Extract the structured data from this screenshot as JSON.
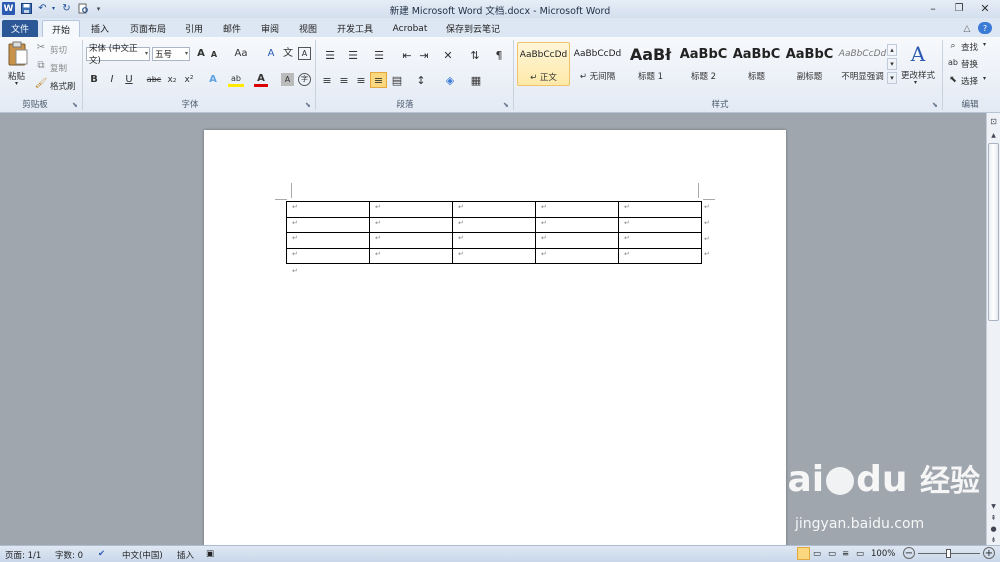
{
  "window": {
    "title": "新建 Microsoft Word 文档.docx - Microsoft Word",
    "app_logo_letter": "W",
    "controls": {
      "minimize": "–",
      "maximize": "❐",
      "close": "✕"
    }
  },
  "quick_access": {
    "save": "💾",
    "undo": "↶",
    "redo": "↻",
    "print_preview": "🔍",
    "customize": "▾"
  },
  "tabs": [
    {
      "label": "文件",
      "id": "file"
    },
    {
      "label": "开始",
      "id": "home"
    },
    {
      "label": "插入",
      "id": "insert"
    },
    {
      "label": "页面布局",
      "id": "layout"
    },
    {
      "label": "引用",
      "id": "references"
    },
    {
      "label": "邮件",
      "id": "mailings"
    },
    {
      "label": "审阅",
      "id": "review"
    },
    {
      "label": "视图",
      "id": "view"
    },
    {
      "label": "开发工具",
      "id": "developer"
    },
    {
      "label": "Acrobat",
      "id": "acrobat"
    },
    {
      "label": "保存到云笔记",
      "id": "cloudnote"
    }
  ],
  "ribbon_right_icons": {
    "help": "?",
    "collapse": "△"
  },
  "clipboard": {
    "group_label": "剪贴板",
    "paste": "粘贴",
    "cut": "剪切",
    "copy": "复制",
    "format_painter": "格式刷"
  },
  "font": {
    "group_label": "字体",
    "font_name": "宋体 (中文正文)",
    "font_size": "五号",
    "grow": "A",
    "shrink": "A",
    "change_case": "Aa",
    "clear": "A",
    "phonetic": "文",
    "border": "A",
    "bold": "B",
    "italic": "I",
    "underline": "U",
    "strike": "abc",
    "subscript": "x₂",
    "superscript": "x²",
    "text_effect": "A",
    "highlight": "ab",
    "font_color": "A",
    "shading": "A",
    "enclose": "字"
  },
  "paragraph": {
    "group_label": "段落"
  },
  "styles": {
    "group_label": "样式",
    "items": [
      {
        "preview": "AaBbCcDd",
        "name": "↵ 正文"
      },
      {
        "preview": "AaBbCcDd",
        "name": "↵ 无间隔"
      },
      {
        "preview": "AaBł",
        "name": "标题 1"
      },
      {
        "preview": "AaBbC",
        "name": "标题 2"
      },
      {
        "preview": "AaBbC",
        "name": "标题"
      },
      {
        "preview": "AaBbC",
        "name": "副标题"
      },
      {
        "preview": "AaBbCcDd",
        "name": "不明显强调"
      }
    ],
    "change_styles": "更改样式"
  },
  "editing": {
    "group_label": "编辑",
    "find": "查找",
    "replace": "替换",
    "select": "选择"
  },
  "document": {
    "table": {
      "rows": 4,
      "cols": 5,
      "cell_mark": "↵",
      "row_end_mark": "↵"
    },
    "paragraph_mark": "↵"
  },
  "statusbar": {
    "page": "页面: 1/1",
    "words": "字数: 0",
    "language": "中文(中国)",
    "mode": "插入",
    "zoom": "100%",
    "zoom_out": "−",
    "zoom_in": "+"
  },
  "watermark": {
    "brand": "Bai",
    "brand2": "du",
    "cn": "经验",
    "url": "jingyan.baidu.com"
  }
}
